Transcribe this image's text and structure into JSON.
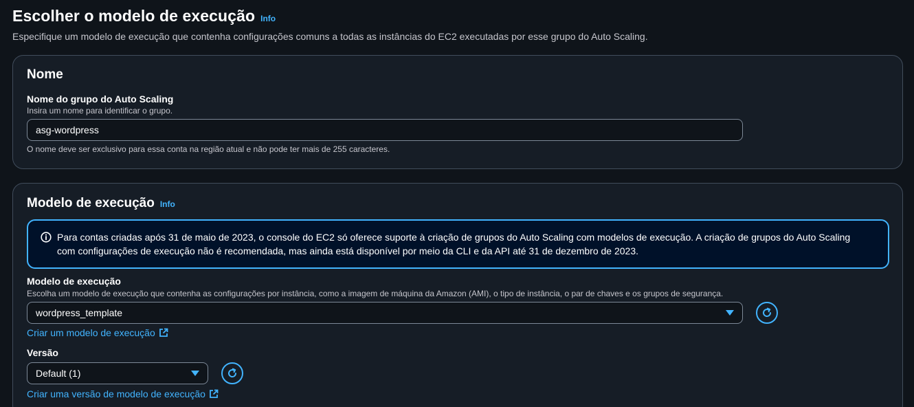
{
  "header": {
    "title": "Escolher o modelo de execução",
    "info_label": "Info",
    "description": "Especifique um modelo de execução que contenha configurações comuns a todas as instâncias do EC2 executadas por esse grupo do Auto Scaling."
  },
  "name_section": {
    "title": "Nome",
    "field_label": "Nome do grupo do Auto Scaling",
    "field_description": "Insira um nome para identificar o grupo.",
    "field_value": "asg-wordpress",
    "constraint_text": "O nome deve ser exclusivo para essa conta na região atual e não pode ter mais de 255 caracteres."
  },
  "template_section": {
    "title": "Modelo de execução",
    "info_label": "Info",
    "alert_text": "Para contas criadas após 31 de maio de 2023, o console do EC2 só oferece suporte à criação de grupos do Auto Scaling com modelos de execução. A criação de grupos do Auto Scaling com configurações de execução não é recomendada, mas ainda está disponível por meio da CLI e da API até 31 de dezembro de 2023.",
    "template_label": "Modelo de execução",
    "template_description": "Escolha um modelo de execução que contenha as configurações por instância, como a imagem de máquina da Amazon (AMI), o tipo de instância, o par de chaves e os grupos de segurança.",
    "template_selected": "wordpress_template",
    "create_template_link": "Criar um modelo de execução",
    "version_label": "Versão",
    "version_selected": "Default (1)",
    "create_version_link": "Criar uma versão de modelo de execução"
  },
  "icons": {
    "info": "info-circle-icon",
    "refresh": "refresh-icon",
    "external": "external-link-icon",
    "dropdown": "caret-down-icon"
  },
  "colors": {
    "background": "#0f141a",
    "card": "#161d26",
    "accent": "#42b4ff",
    "alert_background": "#001129"
  }
}
